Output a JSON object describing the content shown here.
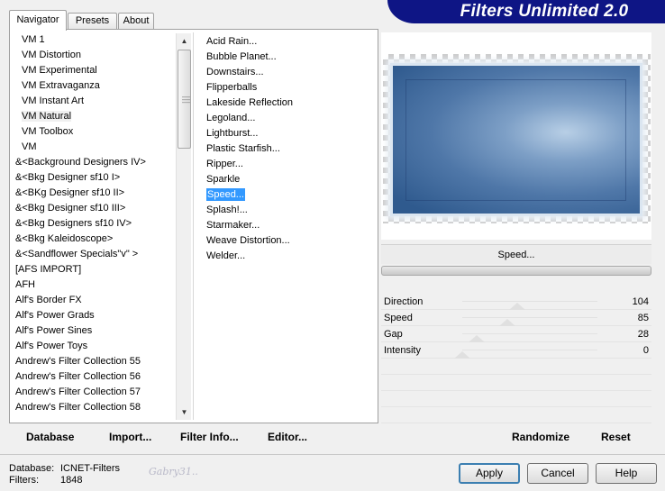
{
  "app_title": "Filters Unlimited 2.0",
  "tabs": [
    {
      "label": "Navigator",
      "active": true
    },
    {
      "label": "Presets",
      "active": false
    },
    {
      "label": "About",
      "active": false
    }
  ],
  "categories": [
    "VM 1",
    "VM Distortion",
    "VM Experimental",
    "VM Extravaganza",
    "VM Instant Art",
    "VM Natural",
    "VM Toolbox",
    "VM",
    "&<Background Designers IV>",
    "&<Bkg Designer sf10 I>",
    "&<BKg Designer sf10 II>",
    "&<Bkg Designer sf10 III>",
    "&<Bkg Designers sf10 IV>",
    "&<Bkg Kaleidoscope>",
    "&<Sandflower Specials\"v\" >",
    "[AFS IMPORT]",
    "AFH",
    "Alf's Border FX",
    "Alf's Power Grads",
    "Alf's Power Sines",
    "Alf's Power Toys",
    "Andrew's Filter Collection 55",
    "Andrew's Filter Collection 56",
    "Andrew's Filter Collection 57",
    "Andrew's Filter Collection 58"
  ],
  "selected_category": "VM Natural",
  "filters": [
    "Acid Rain...",
    "Bubble Planet...",
    "Downstairs...",
    "Flipperballs",
    "Lakeside Reflection",
    "Legoland...",
    "Lightburst...",
    "Plastic Starfish...",
    "Ripper...",
    "Sparkle",
    "Speed...",
    "Splash!...",
    "Starmaker...",
    "Weave Distortion...",
    "Welder..."
  ],
  "selected_filter": "Speed...",
  "current_filter_name": "Speed...",
  "params": [
    {
      "name": "Direction",
      "value": "104",
      "level": 104
    },
    {
      "name": "Speed",
      "value": "85",
      "level": 85
    },
    {
      "name": "Gap",
      "value": "28",
      "level": 28
    },
    {
      "name": "Intensity",
      "value": "0",
      "level": 0
    }
  ],
  "toolbar": {
    "database": "Database",
    "import": "Import...",
    "filter_info": "Filter Info...",
    "editor": "Editor...",
    "randomize": "Randomize",
    "reset": "Reset"
  },
  "status": {
    "database_label": "Database:",
    "database_value": "ICNET-Filters",
    "filters_label": "Filters:",
    "filters_value": "1848",
    "signature": "Gabry31.."
  },
  "buttons": {
    "apply": "Apply",
    "cancel": "Cancel",
    "help": "Help"
  },
  "colors": {
    "banner": "#0e1585",
    "selection": "#3399ff"
  }
}
